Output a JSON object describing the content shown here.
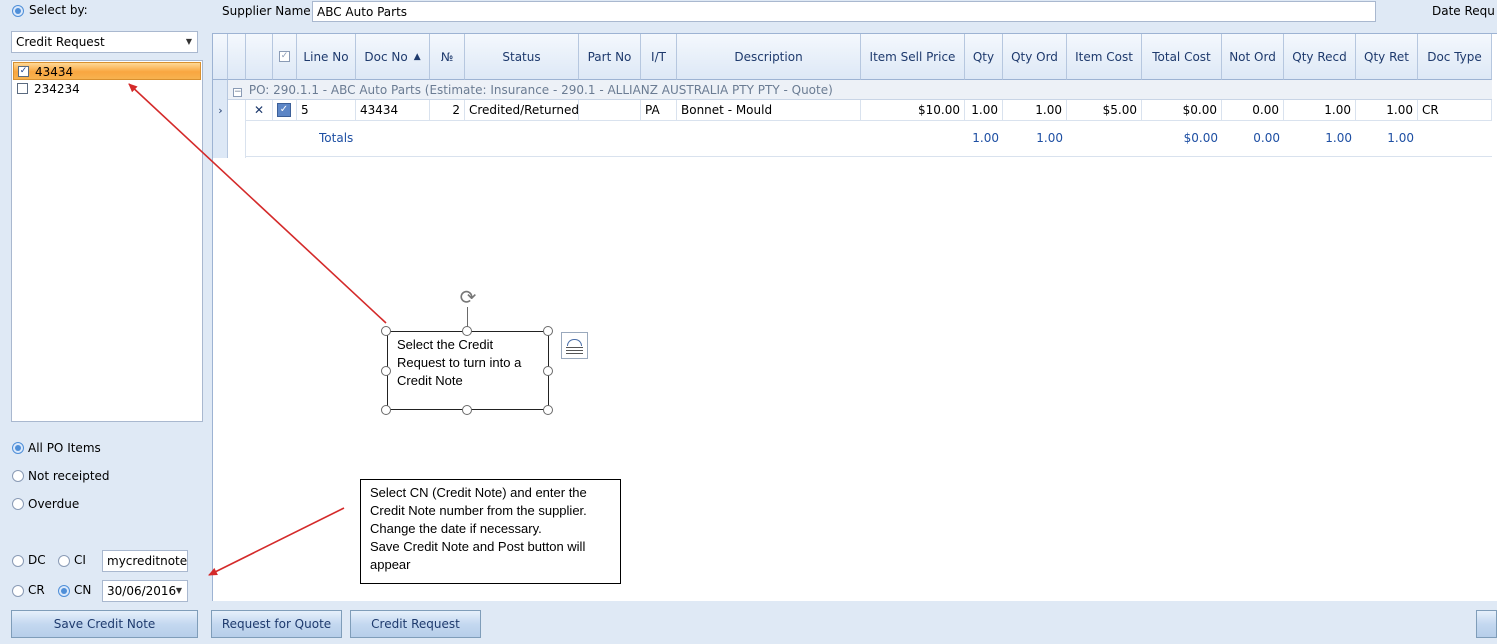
{
  "left_panel": {
    "select_by_label": "Select by:",
    "select_by_value": "Credit Request",
    "list_items": [
      {
        "label": "43434",
        "checked": true,
        "selected": true
      },
      {
        "label": "234234",
        "checked": false,
        "selected": false
      }
    ],
    "filter_options": [
      "All PO Items",
      "Not receipted",
      "Overdue"
    ],
    "doc_type_radios": {
      "dc": "DC",
      "ci": "CI",
      "cr": "CR",
      "cn": "CN"
    },
    "credit_note_number": "mycreditnote",
    "credit_note_date": "30/06/2016"
  },
  "top_bar": {
    "supplier_label": "Supplier Name",
    "supplier_value": "ABC Auto Parts",
    "date_label": "Date Requ"
  },
  "grid": {
    "columns": [
      "Line No",
      "Doc No",
      "№",
      "Status",
      "Part No",
      "I/T",
      "Description",
      "Item Sell Price",
      "Qty",
      "Qty Ord",
      "Item Cost",
      "Total Cost",
      "Not Ord",
      "Qty Recd",
      "Qty Ret",
      "Doc Type"
    ],
    "sort_indicator": "▲",
    "group_row": "PO: 290.1.1 - ABC Auto Parts  (Estimate: Insurance - 290.1 - ALLIANZ AUSTRALIA PTY PTY - Quote)",
    "rows": [
      {
        "delete": "✕",
        "line_no": "5",
        "doc_no": "43434",
        "num": "2",
        "status": "Credited/Returned",
        "part_no": "",
        "it": "PA",
        "description": "Bonnet - Mould",
        "item_sell_price": "$10.00",
        "qty": "1.00",
        "qty_ord": "1.00",
        "item_cost": "$5.00",
        "total_cost": "$0.00",
        "not_ord": "0.00",
        "qty_recd": "1.00",
        "qty_ret": "1.00",
        "doc_type": "CR"
      }
    ],
    "totals": {
      "label": "Totals",
      "qty": "1.00",
      "qty_ord": "1.00",
      "total_cost": "$0.00",
      "not_ord": "0.00",
      "qty_recd": "1.00",
      "qty_ret": "1.00"
    }
  },
  "buttons": {
    "save_credit_note": "Save Credit Note",
    "request_for_quote": "Request for Quote",
    "credit_request": "Credit Request"
  },
  "callouts": {
    "first": "Select the Credit Request to turn into a Credit Note",
    "second_lines": [
      "Select CN (Credit Note) and enter the",
      "Credit Note number from the supplier.",
      "Change the date if necessary.",
      "Save Credit Note and Post button will",
      "appear"
    ]
  },
  "colors": {
    "arrow": "#d42a2a",
    "selected_row": "#f9a640",
    "accent": "#1e4fa3"
  }
}
